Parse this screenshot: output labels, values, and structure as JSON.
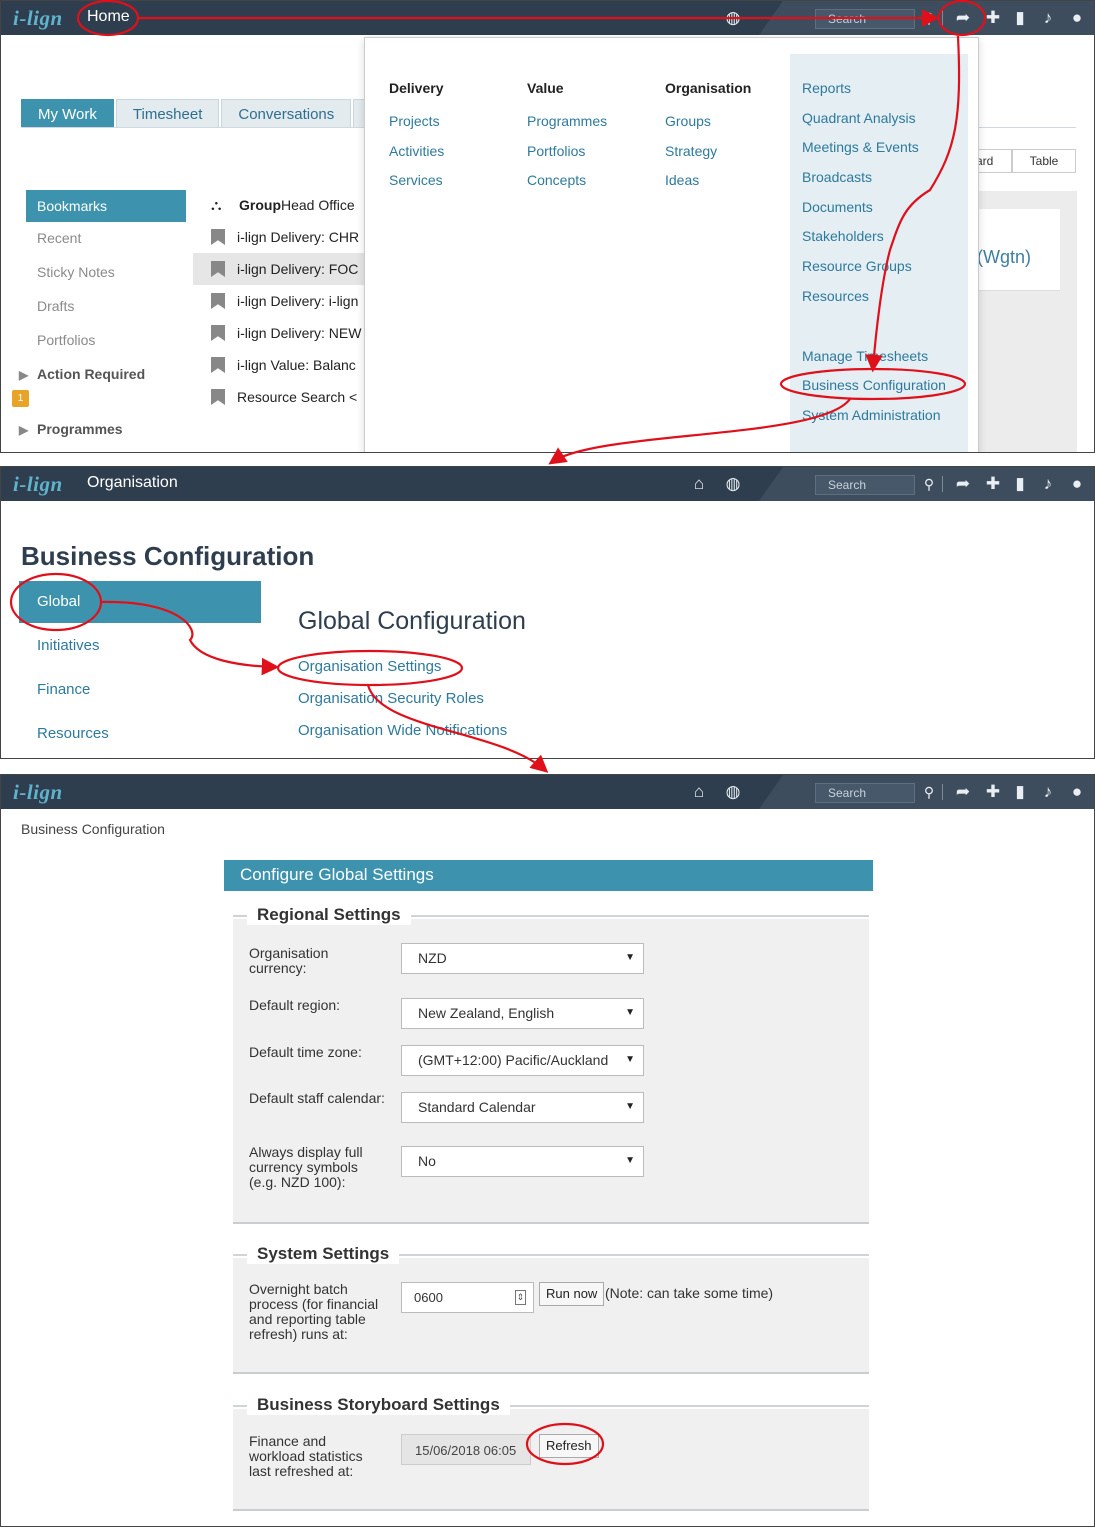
{
  "app": {
    "logo": "i-lign"
  },
  "screen1": {
    "page_label": "Home",
    "search_placeholder": "Search",
    "tabs": [
      "My Work",
      "Timesheet",
      "Conversations"
    ],
    "sidebar": {
      "items": [
        "Bookmarks",
        "Recent",
        "Sticky Notes",
        "Drafts",
        "Portfolios"
      ],
      "action_required": "Action Required",
      "action_count": "1",
      "programmes": "Programmes"
    },
    "bookmarks": {
      "group_bold": "Group",
      "group_rest": " Head Office",
      "items": [
        "i-lign Delivery: CHR",
        "i-lign Delivery: FOC",
        "i-lign Delivery: i-lign",
        "i-lign Delivery: NEW",
        "i-lign Value: Balanc",
        "Resource Search <"
      ]
    },
    "view_toggle": [
      "ard",
      "Table"
    ],
    "bg_text": "(Wgtn)",
    "menu": {
      "delivery": {
        "heading": "Delivery",
        "links": [
          "Projects",
          "Activities",
          "Services"
        ]
      },
      "value": {
        "heading": "Value",
        "links": [
          "Programmes",
          "Portfolios",
          "Concepts"
        ]
      },
      "organisation": {
        "heading": "Organisation",
        "links": [
          "Groups",
          "Strategy",
          "Ideas"
        ]
      },
      "right_links": [
        "Reports",
        "Quadrant Analysis",
        "Meetings & Events",
        "Broadcasts",
        "Documents",
        "Stakeholders",
        "Resource Groups",
        "Resources"
      ],
      "admin_links": [
        "Manage Timesheets",
        "Business Configuration",
        "System Administration"
      ]
    }
  },
  "screen2": {
    "page_label": "Organisation",
    "search_placeholder": "Search",
    "title": "Business Configuration",
    "sidebar": [
      "Global",
      "Initiatives",
      "Finance",
      "Resources"
    ],
    "main_title": "Global Configuration",
    "links": [
      "Organisation Settings",
      "Organisation Security Roles",
      "Organisation Wide Notifications"
    ]
  },
  "screen3": {
    "search_placeholder": "Search",
    "breadcrumb": "Business Configuration",
    "header": "Configure Global Settings",
    "regional": {
      "legend": "Regional Settings",
      "rows": [
        {
          "label": "Organisation currency:",
          "value": "NZD"
        },
        {
          "label": "Default region:",
          "value": "New Zealand, English"
        },
        {
          "label": "Default time zone:",
          "value": "(GMT+12:00) Pacific/Auckland"
        },
        {
          "label": "Default staff calendar:",
          "value": "Standard Calendar"
        },
        {
          "label": "Always display full currency symbols (e.g. NZD 100):",
          "value": "No"
        }
      ]
    },
    "system": {
      "legend": "System Settings",
      "label": "Overnight batch process (for financial and reporting table refresh) runs at:",
      "time": "0600",
      "run_button": "Run now",
      "note": "(Note: can take some time)"
    },
    "storyboard": {
      "legend": "Business Storyboard Settings",
      "label": "Finance and workload statistics last refreshed at:",
      "value": "15/06/2018 06:05",
      "refresh_button": "Refresh"
    }
  },
  "annotation_color": "#e0101b",
  "colors": {
    "topbar": "#2f3e4e",
    "accent": "#3d93ae",
    "link": "#2e7a9c"
  }
}
